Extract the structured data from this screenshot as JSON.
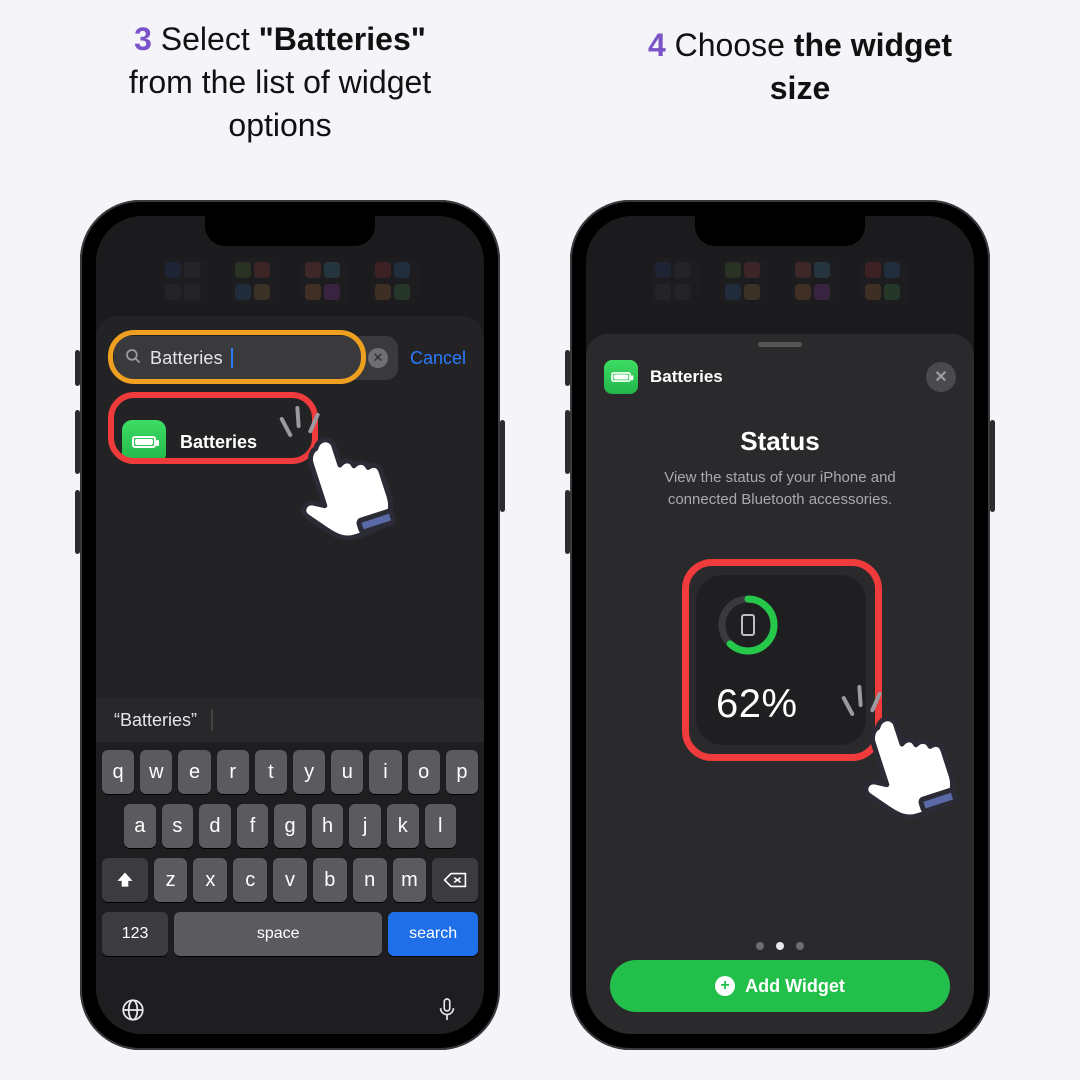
{
  "captions": {
    "left": {
      "num": "3",
      "pre": " Select ",
      "bold": "\"Batteries\"",
      "post_line1": " from the list of widget",
      "post_line2": "options"
    },
    "right": {
      "num": "4",
      "pre": " Choose ",
      "bold_line1": "the widget",
      "bold_line2": "size"
    }
  },
  "left_screen": {
    "search_value": "Batteries",
    "cancel": "Cancel",
    "result_label": "Batteries",
    "quicktype": "“Batteries”",
    "keys_row1": [
      "q",
      "w",
      "e",
      "r",
      "t",
      "y",
      "u",
      "i",
      "o",
      "p"
    ],
    "keys_row2": [
      "a",
      "s",
      "d",
      "f",
      "g",
      "h",
      "j",
      "k",
      "l"
    ],
    "keys_row3": [
      "z",
      "x",
      "c",
      "v",
      "b",
      "n",
      "m"
    ],
    "key_123": "123",
    "key_space": "space",
    "key_search": "search"
  },
  "right_screen": {
    "header_label": "Batteries",
    "title": "Status",
    "desc_line1": "View the status of your iPhone and",
    "desc_line2": "connected Bluetooth accessories.",
    "battery_percent": "62%",
    "battery_percent_value": 62,
    "pager_active_index": 1,
    "add_widget": "Add Widget"
  }
}
